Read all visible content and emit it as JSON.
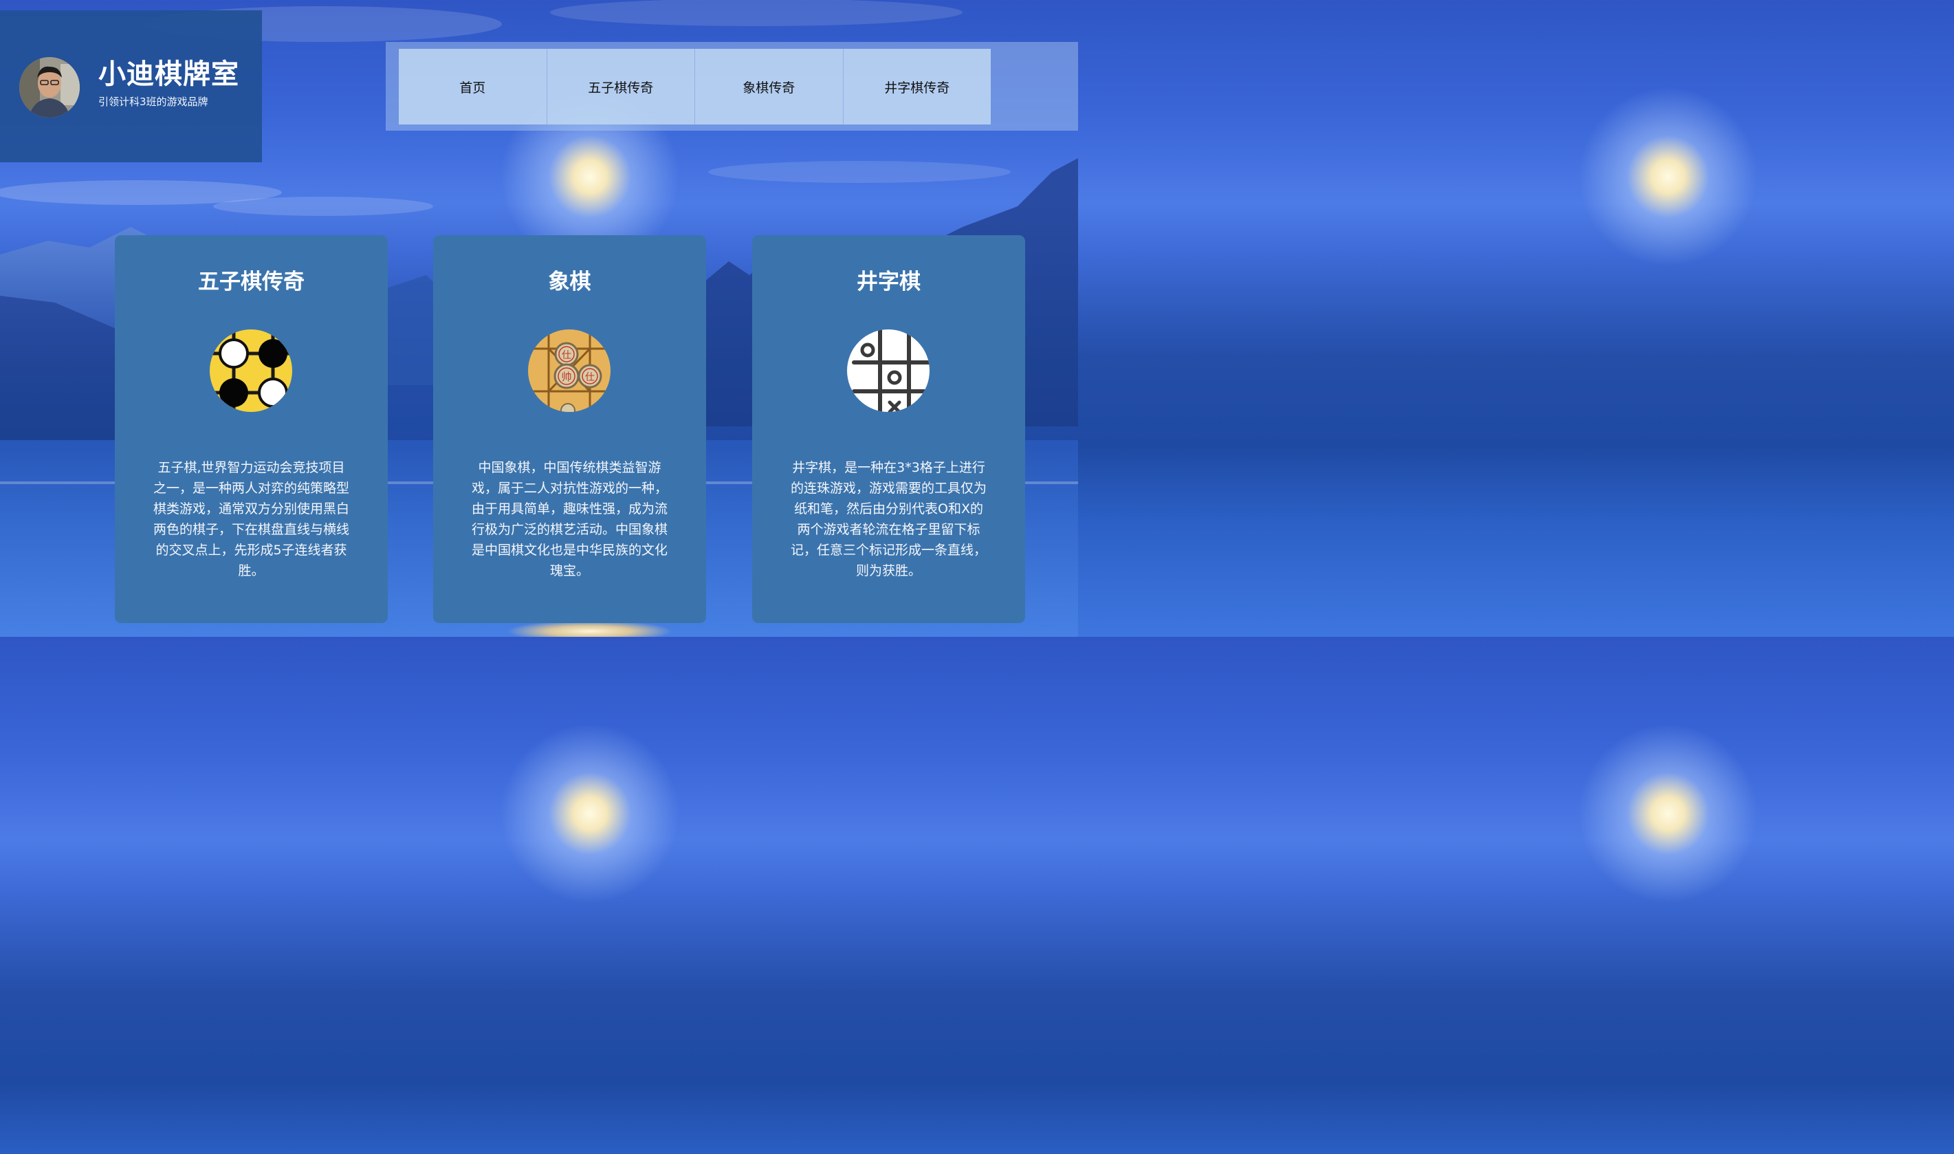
{
  "brand": {
    "title": "小迪棋牌室",
    "subtitle": "引领计科3班的游戏品牌"
  },
  "nav": {
    "items": [
      "首页",
      "五子棋传奇",
      "象棋传奇",
      "井字棋传奇"
    ]
  },
  "cards": [
    {
      "title": "五子棋传奇",
      "icon": "gomoku-icon",
      "description": "五子棋,世界智力运动会竞技项目之一，是一种两人对弈的纯策略型棋类游戏，通常双方分别使用黑白两色的棋子，下在棋盘直线与横线的交叉点上，先形成5子连线者获胜。"
    },
    {
      "title": "象棋",
      "icon": "xiangqi-icon",
      "description": "中国象棋，中国传统棋类益智游戏，属于二人对抗性游戏的一种，由于用具简单，趣味性强，成为流行极为广泛的棋艺活动。中国象棋是中国棋文化也是中华民族的文化瑰宝。"
    },
    {
      "title": "井字棋",
      "icon": "tic-tac-toe-icon",
      "description": "井字棋，是一种在3*3格子上进行的连珠游戏，游戏需要的工具仅为纸和笔，然后由分别代表O和X的两个游戏者轮流在格子里留下标记，任意三个标记形成一条直线，则为获胜。"
    }
  ],
  "colors": {
    "card_bg": "#3b74ad",
    "brand_bg": "#225096",
    "nav_bg": "#bed7f2"
  },
  "xiangqi_pieces": [
    "仕",
    "帅",
    "仕"
  ]
}
